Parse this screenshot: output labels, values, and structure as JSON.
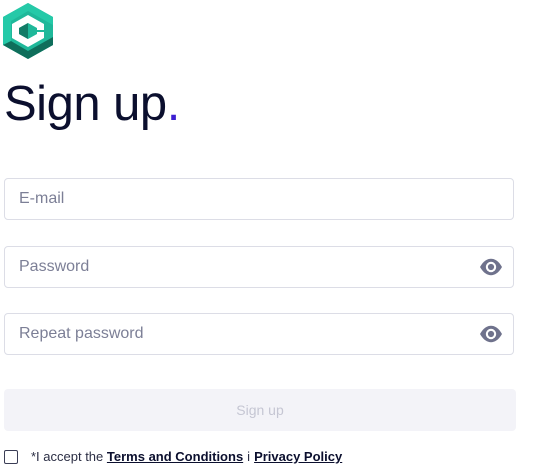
{
  "brand": {
    "logo_icon": "hexagon-c-logo",
    "colors": {
      "logo_light": "#1fb89a",
      "logo_dark": "#127c67",
      "accent_dot": "#3c1fd1"
    }
  },
  "page": {
    "title": "Sign up",
    "title_dot": "."
  },
  "form": {
    "email_placeholder": "E-mail",
    "email_value": "",
    "password_placeholder": "Password",
    "password_value": "",
    "password_toggle_icon": "eye-icon",
    "repeat_password_placeholder": "Repeat password",
    "repeat_password_value": "",
    "submit_label": "Sign up",
    "submit_enabled": false
  },
  "consent": {
    "checked": false,
    "prefix": "*I accept the",
    "terms_label": "Terms and Conditions",
    "separator": "i",
    "privacy_label": "Privacy Policy"
  }
}
